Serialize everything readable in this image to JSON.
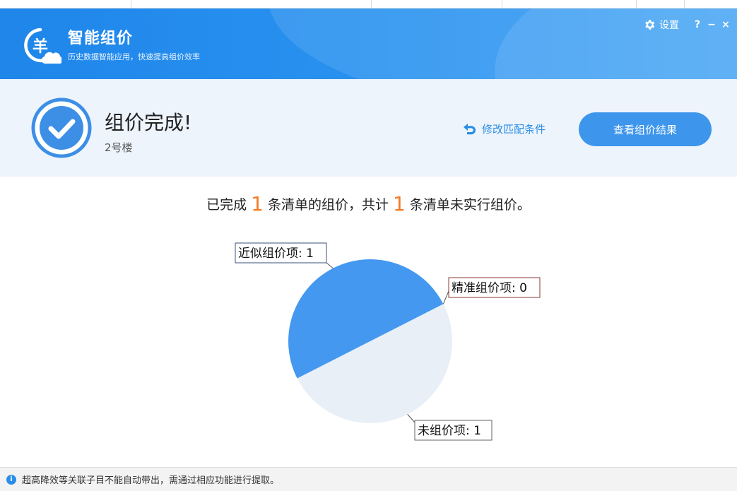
{
  "app": {
    "title": "智能组价",
    "subtitle": "历史数据智能应用，快速提高组价效率"
  },
  "window": {
    "settings_label": "设置",
    "help_label": "?",
    "minimize_label": "−",
    "close_label": "×"
  },
  "status": {
    "title": "组价完成!",
    "building": "2号楼",
    "modify_link": "修改匹配条件",
    "view_button": "查看组价结果"
  },
  "summary": {
    "part1": "已完成",
    "count_done": "1",
    "part2": "条清单的组价，共计",
    "count_pending": "1",
    "part3": "条清单未实行组价。"
  },
  "chart_data": {
    "type": "pie",
    "series": [
      {
        "label": "近似组价项: 1",
        "value": 1,
        "color": "#4498f0"
      },
      {
        "label": "精准组价项: 0",
        "value": 0,
        "color": "#c0504d"
      },
      {
        "label": "未组价项: 1",
        "value": 1,
        "color": "#e8eff6"
      }
    ]
  },
  "footer": {
    "notice": "超高降效等关联子目不能自动带出，需通过相应功能进行提取。"
  },
  "colors": {
    "header": "#1f86ea",
    "accent": "#3d96ec",
    "highlight": "#f07b25"
  }
}
